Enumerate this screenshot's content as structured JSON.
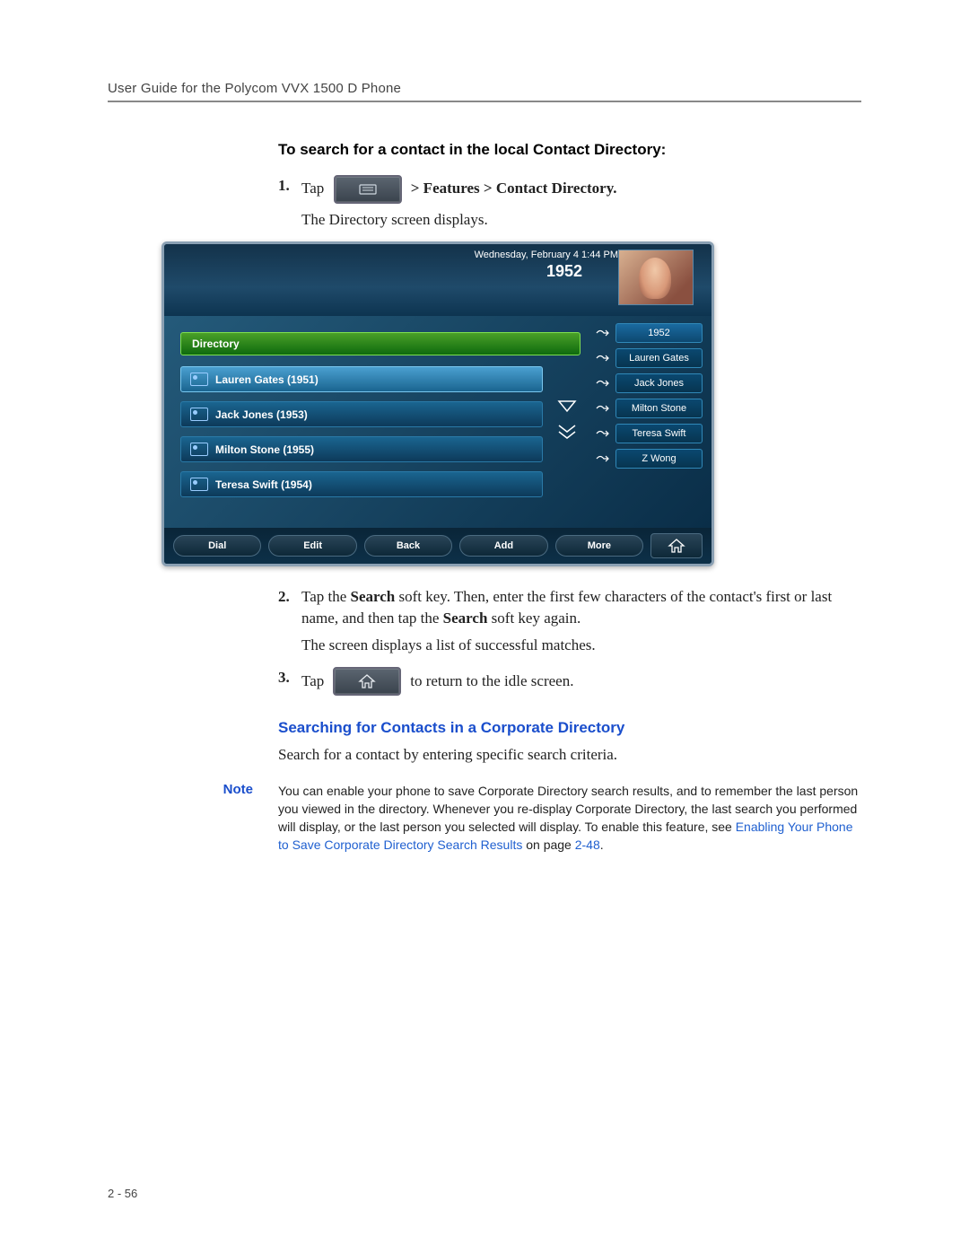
{
  "header": "User Guide for the Polycom VVX 1500 D Phone",
  "h1": "To search for a contact in the local Contact Directory:",
  "step1": {
    "num": "1.",
    "pre": "Tap",
    "post": "> Features > Contact Directory."
  },
  "step1_after": "The Directory screen displays.",
  "phone": {
    "datetime": "Wednesday, February 4  1:44 PM",
    "ext": "1952",
    "title": "Directory",
    "contacts": [
      {
        "name": "Lauren Gates (1951)",
        "sel": true
      },
      {
        "name": "Jack Jones (1953)",
        "sel": false
      },
      {
        "name": "Milton Stone (1955)",
        "sel": false
      },
      {
        "name": "Teresa Swift (1954)",
        "sel": false
      }
    ],
    "side": [
      "1952",
      "Lauren Gates",
      "Jack Jones",
      "Milton Stone",
      "Teresa Swift",
      "Z Wong"
    ],
    "softkeys": [
      "Dial",
      "Edit",
      "Back",
      "Add",
      "More"
    ]
  },
  "step2": {
    "num": "2.",
    "a": "Tap the ",
    "b": "Search",
    "c": " soft key. Then, enter the first few characters of the contact's first or last name, and then tap the ",
    "d": "Search",
    "e": " soft key again."
  },
  "step2_after": "The screen displays a list of successful matches.",
  "step3": {
    "num": "3.",
    "pre": "Tap",
    "post": "to return to the idle screen."
  },
  "h2": "Searching for Contacts in a Corporate Directory",
  "p1": "Search for a contact by entering specific search criteria.",
  "note": {
    "label": "Note",
    "t1": "You can enable your phone to save Corporate Directory search results, and to remember the last person you viewed in the directory. Whenever you re-display Corporate Directory, the last search you performed will display, or the last person you selected will display. To enable this feature, see ",
    "link1": "Enabling Your Phone to Save Corporate Directory Search Results",
    "t2": " on page ",
    "link2": "2-48",
    "t3": "."
  },
  "pagenum": "2 - 56"
}
